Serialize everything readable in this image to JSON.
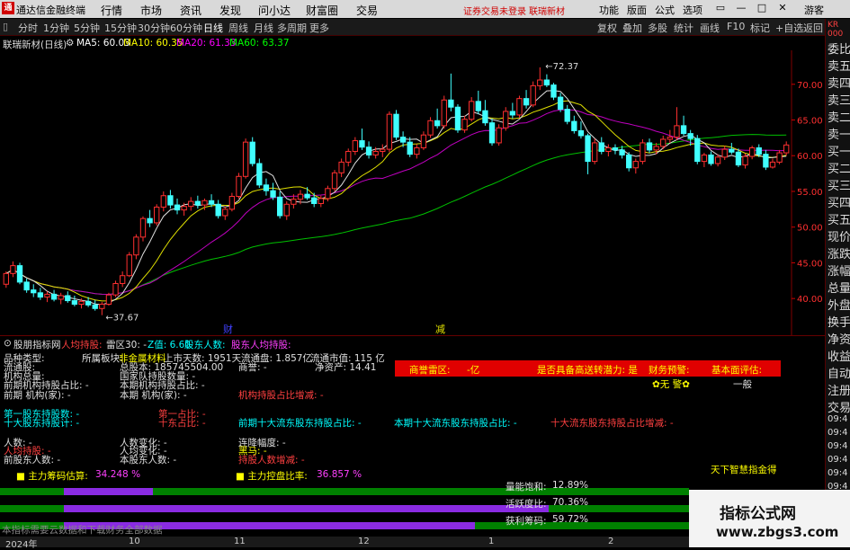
{
  "app": {
    "logo": "通",
    "name": "通达信金融终端"
  },
  "menus": [
    "行情",
    "市场",
    "资讯",
    "发现",
    "问小达",
    "财富圈",
    "交易"
  ],
  "status": {
    "login": "证券交易未登录",
    "stock": "联瑞新材"
  },
  "right_menus": [
    "功能",
    "版面",
    "公式",
    "选项",
    "游客"
  ],
  "window_buttons": [
    "▭",
    "—",
    "□",
    "✕"
  ],
  "periods": [
    "分时",
    "1分钟",
    "5分钟",
    "15分钟",
    "30分钟",
    "60分钟",
    "日线",
    "周线",
    "月线",
    "多周期",
    "更多"
  ],
  "active_period": "日线",
  "tools": [
    "复权",
    "叠加",
    "多股",
    "统计",
    "画线",
    "F10",
    "标记",
    "+自选",
    "返回"
  ],
  "ma": {
    "title": "联瑞新材(日线)",
    "ma5": "MA5: 60.03",
    "ma10": "MA10: 60.35",
    "ma20": "MA20: 61.33",
    "ma60": "MA60: 63.37"
  },
  "right_panel": {
    "top": [
      "KR",
      "000"
    ],
    "items": [
      "委比",
      "卖五",
      "卖四",
      "卖三",
      "卖二",
      "卖一",
      "买一",
      "买二",
      "买三",
      "买四",
      "买五",
      "现价",
      "涨跌",
      "涨幅",
      "总量",
      "外盘",
      "换手",
      "净资",
      "收益",
      "自动",
      "注册",
      "交易"
    ],
    "times": [
      "09:4",
      "09:4",
      "09:4",
      "09:4",
      "09:4",
      "09:4",
      "09:4",
      "09:4",
      "09:4",
      "09:4"
    ]
  },
  "chart_data": {
    "type": "candlestick",
    "ylim": [
      37,
      74
    ],
    "y_ticks": [
      "70.00",
      "65.00",
      "60.00",
      "55.00",
      "50.00",
      "45.00",
      "40.00"
    ],
    "y_tick_values": [
      70,
      65,
      60,
      55,
      50,
      45,
      40
    ],
    "annotations": {
      "high": "72.37",
      "low": "37.67"
    },
    "markers": [
      "财",
      "减"
    ],
    "candles": [
      [
        42,
        43.8,
        41.5,
        43.5
      ],
      [
        43.5,
        45.2,
        43,
        44.6
      ],
      [
        44.6,
        45,
        42,
        42.3
      ],
      [
        42.3,
        42.8,
        40.8,
        41.2
      ],
      [
        41.2,
        42,
        40.2,
        40.8
      ],
      [
        40.8,
        41.5,
        39.8,
        40.2
      ],
      [
        40.2,
        41,
        39.5,
        40.6
      ],
      [
        40.6,
        41.2,
        39.6,
        39.9
      ],
      [
        39.9,
        40.8,
        39.2,
        40.4
      ],
      [
        40.4,
        41,
        39.4,
        39.7
      ],
      [
        39.7,
        40.4,
        38.9,
        39.2
      ],
      [
        39.2,
        40,
        38.6,
        39.6
      ],
      [
        39.6,
        40.2,
        38.8,
        39.1
      ],
      [
        39.1,
        39.8,
        38.3,
        38.6
      ],
      [
        38.6,
        39.5,
        37.67,
        39.2
      ],
      [
        39.2,
        40.8,
        39,
        40.5
      ],
      [
        40.5,
        42.5,
        40.2,
        42.1
      ],
      [
        42.1,
        43.8,
        41.6,
        43.2
      ],
      [
        43.2,
        46.5,
        43,
        46.1
      ],
      [
        46.1,
        49,
        45.5,
        48.6
      ],
      [
        48.6,
        51.5,
        48,
        51.2
      ],
      [
        51.2,
        52.4,
        50,
        50.6
      ],
      [
        50.6,
        53.2,
        50.2,
        52.8
      ],
      [
        52.8,
        55,
        52.2,
        54.4
      ],
      [
        54.4,
        55.2,
        52.6,
        53.1
      ],
      [
        53.1,
        54,
        51.8,
        52.4
      ],
      [
        52.4,
        53.4,
        51.6,
        52.9
      ],
      [
        52.9,
        54.2,
        52.3,
        53.6
      ],
      [
        53.6,
        54.4,
        52.6,
        53.1
      ],
      [
        53.1,
        54,
        52.4,
        53.7
      ],
      [
        53.7,
        54.6,
        52.8,
        53.2
      ],
      [
        53.2,
        53.8,
        51.2,
        51.6
      ],
      [
        51.6,
        52.9,
        51,
        52.5
      ],
      [
        52.5,
        54.8,
        52.2,
        54.3
      ],
      [
        54.3,
        57.6,
        54,
        57.1
      ],
      [
        57.1,
        62.4,
        56.8,
        61.9
      ],
      [
        61.9,
        62.6,
        58.5,
        58.9
      ],
      [
        58.9,
        59.6,
        55.5,
        55.9
      ],
      [
        55.9,
        56.8,
        54.4,
        55.1
      ],
      [
        55.1,
        56.2,
        53.8,
        54.2
      ],
      [
        54.2,
        55,
        51.2,
        51.6
      ],
      [
        51.6,
        53.6,
        51,
        53.2
      ],
      [
        53.2,
        54.6,
        52.6,
        53.9
      ],
      [
        53.9,
        55.2,
        53.2,
        54.6
      ],
      [
        54.6,
        55.6,
        53.8,
        54.1
      ],
      [
        54.1,
        54.8,
        52.8,
        53.3
      ],
      [
        53.3,
        54.4,
        52.8,
        54
      ],
      [
        54,
        55.8,
        53.6,
        55.4
      ],
      [
        55.4,
        58,
        55,
        57.6
      ],
      [
        57.6,
        59.6,
        57,
        59.1
      ],
      [
        59.1,
        61,
        58.5,
        60.6
      ],
      [
        60.6,
        62.6,
        60.1,
        62.1
      ],
      [
        62.1,
        63.8,
        60.8,
        61.2
      ],
      [
        61.2,
        62,
        59.6,
        60.1
      ],
      [
        60.1,
        61.2,
        59.6,
        60.6
      ],
      [
        60.6,
        61.6,
        59.8,
        60.9
      ],
      [
        60.9,
        66.2,
        60.5,
        65.8
      ],
      [
        65.8,
        66.4,
        62.2,
        62.6
      ],
      [
        62.6,
        63.4,
        61.2,
        61.9
      ],
      [
        61.9,
        62.6,
        59.8,
        60.2
      ],
      [
        60.2,
        61.6,
        59.6,
        61.1
      ],
      [
        61.1,
        63.4,
        60.8,
        62.9
      ],
      [
        62.9,
        65.4,
        62.5,
        64.9
      ],
      [
        64.9,
        66.6,
        63.8,
        64.2
      ],
      [
        64.2,
        68.4,
        63.8,
        67.8
      ],
      [
        67.8,
        71.5,
        66.2,
        66.8
      ],
      [
        66.8,
        67.2,
        63.2,
        63.6
      ],
      [
        63.6,
        65.6,
        63.2,
        65.1
      ],
      [
        65.1,
        68.2,
        64.8,
        67.6
      ],
      [
        67.6,
        69.1,
        65.8,
        66.3
      ],
      [
        66.3,
        67.8,
        64.2,
        64.6
      ],
      [
        64.6,
        65.2,
        61.4,
        61.8
      ],
      [
        61.8,
        64.4,
        61.4,
        63.9
      ],
      [
        63.9,
        66.8,
        63.5,
        66.2
      ],
      [
        66.2,
        67.4,
        65.2,
        65.7
      ],
      [
        65.7,
        68.4,
        65.3,
        68
      ],
      [
        68,
        69.2,
        66.6,
        67.1
      ],
      [
        67.1,
        70.4,
        66.8,
        69.8
      ],
      [
        69.8,
        72.37,
        69.2,
        70.6
      ],
      [
        70.6,
        71.4,
        69.6,
        69.9
      ],
      [
        69.9,
        70.2,
        67.8,
        68.2
      ],
      [
        68.2,
        68.8,
        66.1,
        66.5
      ],
      [
        66.5,
        67.1,
        64.4,
        64.8
      ],
      [
        64.8,
        65.6,
        63.1,
        63.5
      ],
      [
        63.5,
        64.8,
        62.4,
        62.8
      ],
      [
        62.8,
        63.1,
        57.4,
        59.2
      ],
      [
        59.2,
        62.4,
        58.8,
        61.8
      ],
      [
        61.8,
        62.6,
        60.2,
        60.6
      ],
      [
        60.6,
        61.6,
        59.9,
        61.1
      ],
      [
        61.1,
        61.6,
        60.2,
        60.8
      ],
      [
        60.8,
        61.4,
        59.6,
        60.1
      ],
      [
        60.1,
        60.5,
        57.8,
        58.3
      ],
      [
        58.3,
        59.6,
        57.5,
        59.2
      ],
      [
        59.2,
        62.3,
        58.8,
        61.8
      ],
      [
        61.8,
        62.4,
        60.4,
        60.8
      ],
      [
        60.8,
        61.8,
        60.2,
        61.3
      ],
      [
        61.3,
        62.8,
        60.9,
        62.3
      ],
      [
        62.3,
        63.6,
        61.8,
        62.6
      ],
      [
        62.6,
        66.8,
        62.2,
        64.2
      ],
      [
        64.2,
        65.6,
        62.8,
        63.1
      ],
      [
        63.1,
        63.6,
        61.4,
        62.4
      ],
      [
        62.4,
        62.9,
        58.8,
        59.2
      ],
      [
        59.2,
        60.4,
        58.4,
        60.1
      ],
      [
        60.1,
        60.6,
        58.6,
        58.9
      ],
      [
        58.9,
        60.2,
        58.5,
        59.8
      ],
      [
        59.8,
        61.4,
        59.4,
        60.9
      ],
      [
        60.9,
        61.8,
        60.2,
        60.5
      ],
      [
        60.5,
        61,
        58.4,
        58.7
      ],
      [
        58.7,
        60.3,
        58.2,
        59.9
      ],
      [
        59.9,
        61.4,
        59.5,
        61.1
      ],
      [
        61.1,
        61.6,
        59.8,
        60.2
      ],
      [
        60.2,
        60.8,
        58,
        58.4
      ],
      [
        58.4,
        59.6,
        58.2,
        59.1
      ],
      [
        59.1,
        60.8,
        58.8,
        60.4
      ],
      [
        60.4,
        62,
        60,
        61.5
      ]
    ]
  },
  "indicator": {
    "title": "股朋指标网",
    "row0": [
      "人均持股:",
      "雷区30: -",
      "Z值: 6.60",
      "股东人数:",
      "股东人均持股:"
    ],
    "lines": [
      {
        "t": "品种类型:",
        "c": "w"
      },
      {
        "t": "所属板块:",
        "c": "w"
      },
      {
        "t": "非金属材料",
        "c": "y"
      },
      {
        "t": "上市天数: 1951天",
        "c": "w"
      },
      {
        "t": "流通盘:  1.857亿",
        "c": "w"
      },
      {
        "t": "流通市值:  115 亿",
        "c": "w"
      },
      {
        "t": "流通股:",
        "c": "w"
      },
      {
        "t": "总股本: 185745504.00",
        "c": "w"
      },
      {
        "t": "商誉: -",
        "c": "w"
      },
      {
        "t": "净资产: 14.41",
        "c": "w"
      },
      {
        "t": "机构总量:",
        "c": "w"
      },
      {
        "t": "国家队持股数量: -",
        "c": "w"
      },
      {
        "t": "前期机构持股占比: -",
        "c": "w"
      },
      {
        "t": "本期机构持股占比: -",
        "c": "w"
      },
      {
        "t": "前期 机构(家): -",
        "c": "w"
      },
      {
        "t": "本期 机构(家): -",
        "c": "w"
      },
      {
        "t": "机构持股占比增减: -",
        "c": "r"
      },
      {
        "t": "第一股东持股数: -",
        "c": "c"
      },
      {
        "t": "第一占比: -",
        "c": "r"
      },
      {
        "t": "十大股东持股计: -",
        "c": "c"
      },
      {
        "t": "十东占比: -",
        "c": "r"
      },
      {
        "t": "前期十大流东股东持股占比: -",
        "c": "c"
      },
      {
        "t": "本期十大流东股东持股占比: -",
        "c": "c"
      },
      {
        "t": "十大流东股东持股占比增减: -",
        "c": "r"
      },
      {
        "t": "人数: -",
        "c": "w"
      },
      {
        "t": "人数变化: -",
        "c": "w"
      },
      {
        "t": "连降幅度: -",
        "c": "w"
      },
      {
        "t": "人均持股: -",
        "c": "r"
      },
      {
        "t": "人均变化: -",
        "c": "w"
      },
      {
        "t": "黑马: -",
        "c": "y"
      },
      {
        "t": "前股东人数: -",
        "c": "w"
      },
      {
        "t": "本股东人数: -",
        "c": "w"
      },
      {
        "t": "持股人数增减: -",
        "c": "r"
      }
    ],
    "redbox": [
      "商誉雷区:",
      "-亿",
      "是否具备高送转潜力: 是",
      "财务预警:",
      "基本面评估:"
    ],
    "below_red": [
      "✿无 警✿",
      "一般"
    ],
    "zhuli": {
      "label1": "主力筹码估算:",
      "val1": "34.248 %",
      "label2": "主力控盘比率:",
      "val2": "36.857 %"
    },
    "brand": "天下智慧指金得",
    "meters": [
      {
        "label": "量能饱和:",
        "val": "12.89%",
        "fill": 0.1289
      },
      {
        "label": "活跃度比:",
        "val": "70.36%",
        "fill": 0.7036
      },
      {
        "label": "获利筹码:",
        "val": "59.72%",
        "fill": 0.5972
      }
    ],
    "footnote": "本指标需要云数据和下载财务全部数据"
  },
  "watermark": {
    "line1": "指标公式网",
    "line2": "www.zbgs3.com"
  },
  "bottom_axis": [
    "2024年",
    "10",
    "11",
    "12",
    "1",
    "2"
  ]
}
